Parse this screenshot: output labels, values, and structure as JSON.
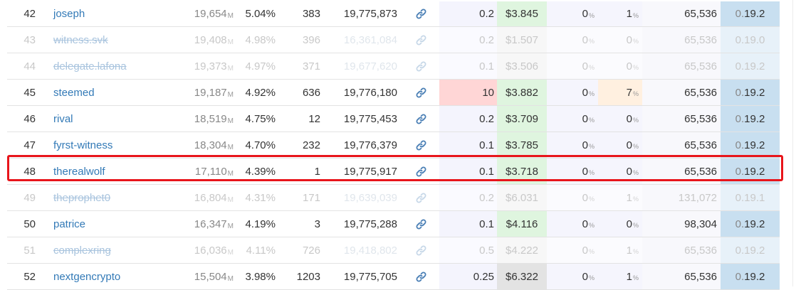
{
  "witnesses": [
    {
      "rank": "42",
      "name": "joseph",
      "votes": "19,654",
      "votes_unit": "M",
      "percent": "5.04%",
      "missed": "383",
      "last_block": "19,775,873",
      "p1": "0.2",
      "price": "$3.845",
      "p2": "0",
      "p2_unit": "%",
      "p3": "1",
      "p3_unit": "%",
      "size": "65,536",
      "ver_prefix": "0.",
      "ver_main": "19.2",
      "disabled": false,
      "p1_style": "",
      "price_style": "",
      "p3_style": "",
      "ver_style": ""
    },
    {
      "rank": "43",
      "name": "witness.svk",
      "votes": "19,408",
      "votes_unit": "M",
      "percent": "4.98%",
      "missed": "396",
      "last_block": "16,361,084",
      "p1": "0.2",
      "price": "$1.507",
      "p2": "0",
      "p2_unit": "%",
      "p3": "0",
      "p3_unit": "%",
      "size": "65,536",
      "ver_prefix": "0.",
      "ver_main": "19.0",
      "disabled": true,
      "p1_style": "faint",
      "price_style": "faint",
      "p3_style": "",
      "ver_style": "faint"
    },
    {
      "rank": "44",
      "name": "delegate.lafona",
      "votes": "19,373",
      "votes_unit": "M",
      "percent": "4.97%",
      "missed": "371",
      "last_block": "19,677,620",
      "p1": "0.1",
      "price": "$3.506",
      "p2": "0",
      "p2_unit": "%",
      "p3": "0",
      "p3_unit": "%",
      "size": "65,536",
      "ver_prefix": "0.",
      "ver_main": "19.2",
      "disabled": true,
      "p1_style": "faint",
      "price_style": "faint",
      "p3_style": "",
      "ver_style": "faint"
    },
    {
      "rank": "45",
      "name": "steemed",
      "votes": "19,187",
      "votes_unit": "M",
      "percent": "4.92%",
      "missed": "636",
      "last_block": "19,776,180",
      "p1": "10",
      "price": "$3.882",
      "p2": "0",
      "p2_unit": "%",
      "p3": "7",
      "p3_unit": "%",
      "size": "65,536",
      "ver_prefix": "0.",
      "ver_main": "19.2",
      "disabled": false,
      "p1_style": "red",
      "price_style": "",
      "p3_style": "orange",
      "ver_style": ""
    },
    {
      "rank": "46",
      "name": "rival",
      "votes": "18,519",
      "votes_unit": "M",
      "percent": "4.75%",
      "missed": "12",
      "last_block": "19,775,453",
      "p1": "0.2",
      "price": "$3.709",
      "p2": "0",
      "p2_unit": "%",
      "p3": "0",
      "p3_unit": "%",
      "size": "65,536",
      "ver_prefix": "0.",
      "ver_main": "19.2",
      "disabled": false,
      "p1_style": "",
      "price_style": "",
      "p3_style": "",
      "ver_style": ""
    },
    {
      "rank": "47",
      "name": "fyrst-witness",
      "votes": "18,304",
      "votes_unit": "M",
      "percent": "4.70%",
      "missed": "232",
      "last_block": "19,776,379",
      "p1": "0.1",
      "price": "$3.785",
      "p2": "0",
      "p2_unit": "%",
      "p3": "0",
      "p3_unit": "%",
      "size": "65,536",
      "ver_prefix": "0.",
      "ver_main": "19.2",
      "disabled": false,
      "p1_style": "",
      "price_style": "",
      "p3_style": "",
      "ver_style": ""
    },
    {
      "rank": "48",
      "name": "therealwolf",
      "votes": "17,110",
      "votes_unit": "M",
      "percent": "4.39%",
      "missed": "1",
      "last_block": "19,775,917",
      "p1": "0.1",
      "price": "$3.718",
      "p2": "0",
      "p2_unit": "%",
      "p3": "0",
      "p3_unit": "%",
      "size": "65,536",
      "ver_prefix": "0.",
      "ver_main": "19.2",
      "disabled": false,
      "p1_style": "",
      "price_style": "",
      "p3_style": "",
      "ver_style": ""
    },
    {
      "rank": "49",
      "name": "theprophet0",
      "votes": "16,804",
      "votes_unit": "M",
      "percent": "4.31%",
      "missed": "171",
      "last_block": "19,639,039",
      "p1": "0.2",
      "price": "$6.031",
      "p2": "0",
      "p2_unit": "%",
      "p3": "1",
      "p3_unit": "%",
      "size": "131,072",
      "ver_prefix": "0.",
      "ver_main": "19.1",
      "disabled": true,
      "p1_style": "faint",
      "price_style": "faint",
      "p3_style": "",
      "ver_style": "faint"
    },
    {
      "rank": "50",
      "name": "patrice",
      "votes": "16,347",
      "votes_unit": "M",
      "percent": "4.19%",
      "missed": "3",
      "last_block": "19,775,288",
      "p1": "0.1",
      "price": "$4.116",
      "p2": "0",
      "p2_unit": "%",
      "p3": "0",
      "p3_unit": "%",
      "size": "98,304",
      "ver_prefix": "0.",
      "ver_main": "19.2",
      "disabled": false,
      "p1_style": "",
      "price_style": "",
      "p3_style": "",
      "ver_style": ""
    },
    {
      "rank": "51",
      "name": "complexring",
      "votes": "16,036",
      "votes_unit": "M",
      "percent": "4.11%",
      "missed": "726",
      "last_block": "19,418,802",
      "p1": "0.5",
      "price": "$4.222",
      "p2": "0",
      "p2_unit": "%",
      "p3": "1",
      "p3_unit": "%",
      "size": "65,536",
      "ver_prefix": "0.",
      "ver_main": "19.2",
      "disabled": true,
      "p1_style": "faint",
      "price_style": "faint",
      "p3_style": "",
      "ver_style": "faint"
    },
    {
      "rank": "52",
      "name": "nextgencrypto",
      "votes": "15,504",
      "votes_unit": "M",
      "percent": "3.98%",
      "missed": "1203",
      "last_block": "19,775,705",
      "p1": "0.25",
      "price": "$6.322",
      "p2": "0",
      "p2_unit": "%",
      "p3": "1",
      "p3_unit": "%",
      "size": "65,536",
      "ver_prefix": "0.",
      "ver_main": "19.2",
      "disabled": false,
      "p1_style": "",
      "price_style": "grey",
      "p3_style": "",
      "ver_style": ""
    }
  ],
  "icons": {
    "link": "link-icon"
  },
  "colors": {
    "link": "#337ab7",
    "highlight": "#e8151b",
    "price_bg": "#dff5df",
    "missed_bg": "#ffd6d6",
    "version_bg": "#c8dff0"
  }
}
